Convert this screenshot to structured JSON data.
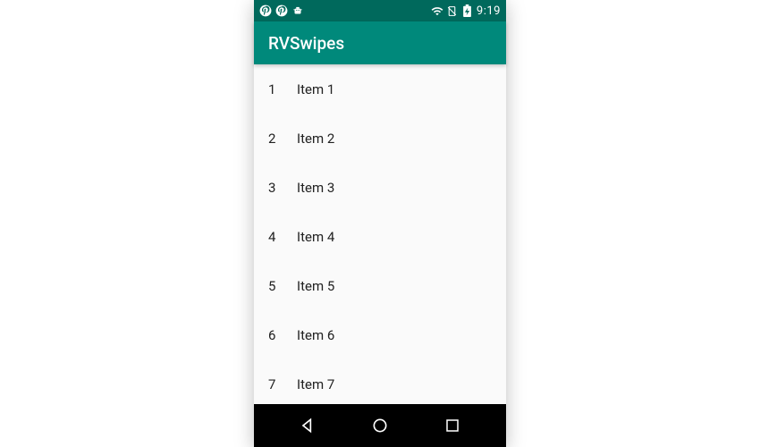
{
  "statusBar": {
    "clock": "9:19"
  },
  "appBar": {
    "title": "RVSwipes"
  },
  "list": {
    "items": [
      {
        "number": "1",
        "label": "Item 1"
      },
      {
        "number": "2",
        "label": "Item 2"
      },
      {
        "number": "3",
        "label": "Item 3"
      },
      {
        "number": "4",
        "label": "Item 4"
      },
      {
        "number": "5",
        "label": "Item 5"
      },
      {
        "number": "6",
        "label": "Item 6"
      },
      {
        "number": "7",
        "label": "Item 7"
      }
    ]
  },
  "colors": {
    "statusBar": "#00695c",
    "appBar": "#00897b",
    "background": "#fafafa",
    "textPrimary": "#212121"
  }
}
